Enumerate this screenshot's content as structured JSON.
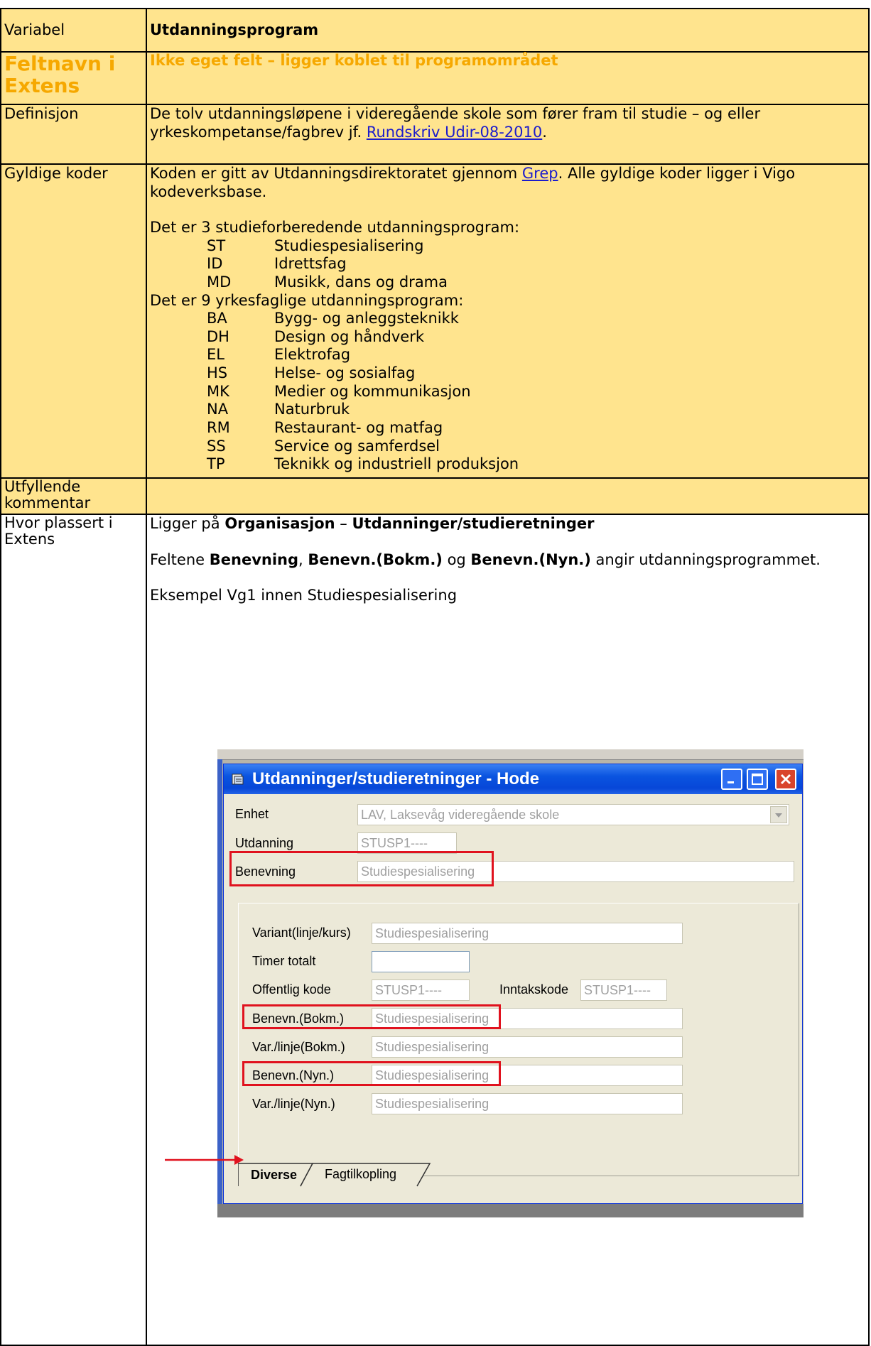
{
  "rows": {
    "variabel": {
      "label": "Variabel",
      "value": "Utdanningsprogram"
    },
    "feltnavn": {
      "label": "Feltnavn i Extens",
      "value": "Ikke eget felt – ligger koblet til programområdet"
    },
    "definisjon": {
      "label": "Definisjon",
      "text_before": "De tolv utdanningsløpene i videregående skole som fører fram til studie – og eller yrkeskompetanse/fagbrev jf. ",
      "link": "Rundskriv Udir-08-2010",
      "text_after": "."
    },
    "gyldige": {
      "label": "Gyldige koder",
      "intro_before": "Koden er gitt av Utdanningsdirektoratet gjennom ",
      "intro_link": "Grep",
      "intro_after": ". Alle gyldige koder ligger i Vigo kodeverksbase.",
      "study_heading": "Det er 3 studieforberedende utdanningsprogram:",
      "study_codes": [
        {
          "code": "ST",
          "name": "Studiespesialisering"
        },
        {
          "code": "ID",
          "name": "Idrettsfag"
        },
        {
          "code": "MD",
          "name": "Musikk, dans og drama"
        }
      ],
      "vocational_heading": "Det er 9 yrkesfaglige utdanningsprogram:",
      "vocational_codes": [
        {
          "code": "BA",
          "name": "Bygg- og anleggsteknikk"
        },
        {
          "code": "DH",
          "name": "Design og håndverk"
        },
        {
          "code": "EL",
          "name": "Elektrofag"
        },
        {
          "code": "HS",
          "name": "Helse- og sosialfag"
        },
        {
          "code": "MK",
          "name": "Medier og kommunikasjon"
        },
        {
          "code": "NA",
          "name": "Naturbruk"
        },
        {
          "code": "RM",
          "name": "Restaurant- og matfag"
        },
        {
          "code": "SS",
          "name": "Service og samferdsel"
        },
        {
          "code": "TP",
          "name": "Teknikk og industriell produksjon"
        }
      ]
    },
    "utfyllende": {
      "label": "Utfyllende kommentar",
      "value": ""
    },
    "hvor": {
      "label": "Hvor plassert i Extens",
      "line1_a": "Ligger på ",
      "line1_b": "Organisasjon",
      "line1_c": " – ",
      "line1_d": "Utdanninger/studieretninger",
      "line2_a": "Feltene ",
      "line2_b": "Benevning",
      "line2_c": ", ",
      "line2_d": "Benevn.(Bokm.)",
      "line2_e": " og ",
      "line2_f": "Benevn.(Nyn.)",
      "line2_g": " angir utdanningsprogrammet.",
      "line3": "Eksempel Vg1 innen Studiespesialisering"
    }
  },
  "dialog": {
    "title": "Utdanninger/studieretninger - Hode",
    "enhet_label": "Enhet",
    "enhet_value": "LAV, Laksevåg videregående skole",
    "utdanning_label": "Utdanning",
    "utdanning_value": "STUSP1----",
    "benevning_label": "Benevning",
    "benevning_value": "Studiespesialisering",
    "variant_label": "Variant(linje/kurs)",
    "variant_value": "Studiespesialisering",
    "timer_label": "Timer totalt",
    "timer_value": "",
    "offentlig_label": "Offentlig kode",
    "offentlig_value": "STUSP1----",
    "inntak_label": "Inntakskode",
    "inntak_value": "STUSP1----",
    "benevn_bokm_label": "Benevn.(Bokm.)",
    "benevn_bokm_value": "Studiespesialisering",
    "var_bokm_label": "Var./linje(Bokm.)",
    "var_bokm_value": "Studiespesialisering",
    "benevn_nyn_label": "Benevn.(Nyn.)",
    "benevn_nyn_value": "Studiespesialisering",
    "var_nyn_label": "Var./linje(Nyn.)",
    "var_nyn_value": "Studiespesialisering",
    "tab_diverse": "Diverse",
    "tab_fagtilkopling": "Fagtilkopling"
  },
  "colors": {
    "yellow": "#ffe48e",
    "orange": "#f6a800",
    "highlight": "#e0121e",
    "link": "#1c1ccc"
  }
}
